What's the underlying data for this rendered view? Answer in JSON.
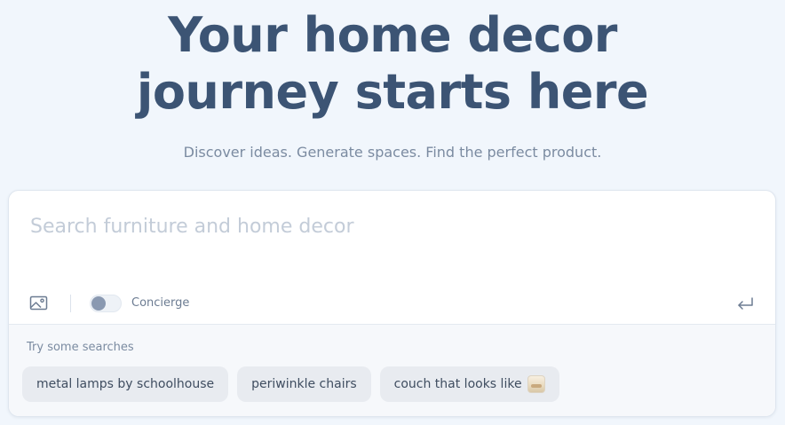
{
  "hero": {
    "title_line1": "Your home decor",
    "title_line2": "journey starts here",
    "subtitle": "Discover ideas. Generate spaces. Find the perfect product."
  },
  "search": {
    "placeholder": "Search furniture and home decor",
    "value": "",
    "toolbar": {
      "image_icon": "image-upload-icon",
      "concierge_label": "Concierge",
      "concierge_on": false,
      "submit_icon": "enter-return-icon"
    }
  },
  "suggestions": {
    "title": "Try some searches",
    "chips": [
      {
        "label": "metal lamps by schoolhouse"
      },
      {
        "label": "periwinkle chairs"
      },
      {
        "label": "couch that looks like",
        "thumbnail_icon": "couch-image-thumbnail"
      }
    ]
  },
  "colors": {
    "background": "#f1f6fc",
    "headline": "#3c5474",
    "muted_text": "#7b8ba1",
    "chip_bg": "#e8ebf0",
    "toggle_knob": "#8a99b1"
  }
}
